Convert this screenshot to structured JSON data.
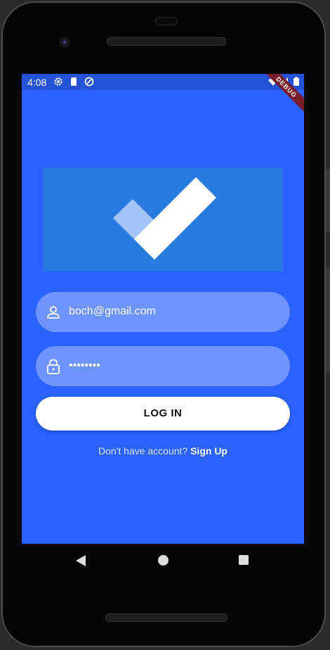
{
  "status_bar": {
    "time": "4:08",
    "debug_label": "DEBUG"
  },
  "email_field": {
    "value": "boch@gmail.com",
    "icon": "person-icon"
  },
  "password_field": {
    "value": "••••••••",
    "icon": "lock-icon"
  },
  "login_button": {
    "label": "LOG IN"
  },
  "signup": {
    "prompt": "Don't have account?",
    "link": "Sign Up"
  },
  "colors": {
    "background": "#2962ff",
    "status_bar": "#2452d9",
    "logo_bg": "#2a7be0",
    "button": "#ffffff"
  }
}
